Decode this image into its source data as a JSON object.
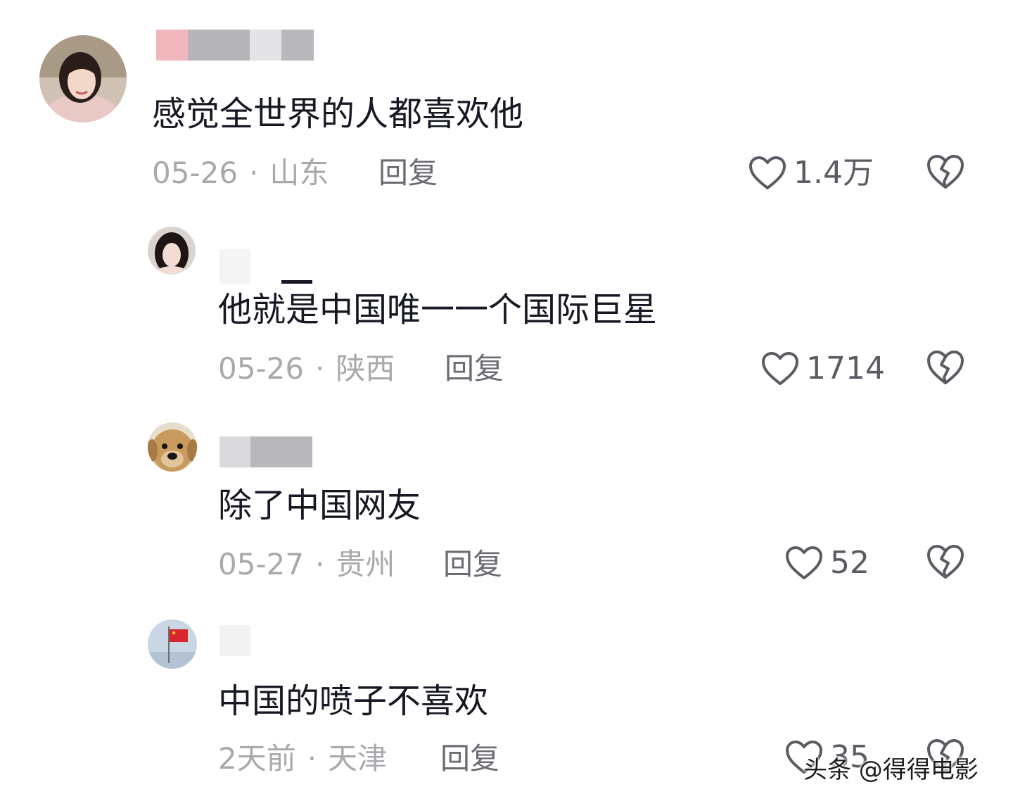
{
  "comments": [
    {
      "text": "感觉全世界的人都喜欢他",
      "date": "05-26",
      "location": "山东",
      "reply_label": "回复",
      "likes": "1.4万",
      "avatar_icon": "avatar-woman-icon"
    },
    {
      "text": "他就是中国唯一一个国际巨星",
      "date": "05-26",
      "location": "陕西",
      "reply_label": "回复",
      "likes": "1714",
      "avatar_icon": "avatar-woman-icon"
    },
    {
      "text": "除了中国网友",
      "date": "05-27",
      "location": "贵州",
      "reply_label": "回复",
      "likes": "52",
      "avatar_icon": "avatar-dog-icon"
    },
    {
      "text": "中国的喷子不喜欢",
      "date": "2天前",
      "location": "天津",
      "reply_label": "回复",
      "likes": "35",
      "avatar_icon": "avatar-flag-icon"
    }
  ],
  "separator": "·",
  "watermark": "头条 @得得电影",
  "colors": {
    "text": "#161823",
    "meta": "#a8a8ad",
    "reply": "#6b6b73",
    "icon": "#5b5b63",
    "flag_red": "#d8262c"
  }
}
